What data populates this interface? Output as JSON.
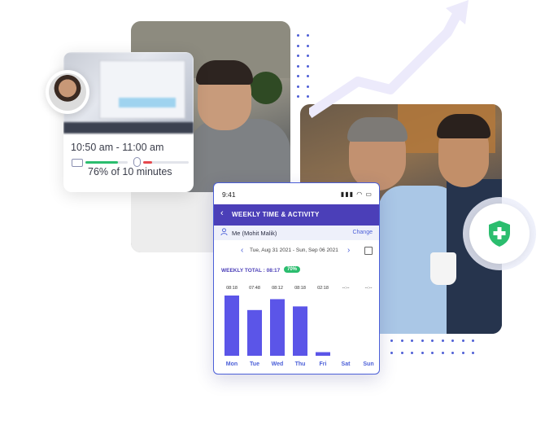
{
  "activity_card": {
    "time_range": "10:50 am - 11:00 am",
    "percent_text": "76% of 10 minutes",
    "keyboard_level": 0.76,
    "mouse_level": 0.2
  },
  "phone": {
    "status_time": "9:41",
    "header_title": "WEEKLY TIME & ACTIVITY",
    "user_name": "Me (Mohit Malik)",
    "change_label": "Change",
    "date_range": "Tue, Aug 31 2021 - Sun, Sep 06 2021",
    "weekly_total_label": "WEEKLY TOTAL : 08:17",
    "weekly_badge": "70%"
  },
  "colors": {
    "accent": "#4b3fb8",
    "bar": "#5b55e8",
    "shield": "#2bbd6e",
    "keyboard_fill": "#2bbd6e",
    "mouse_fill": "#e5484d"
  },
  "chart_data": {
    "type": "bar",
    "categories": [
      "Mon",
      "Tue",
      "Wed",
      "Thu",
      "Fri",
      "Sat",
      "Sun"
    ],
    "labels": [
      "08:18",
      "07:48",
      "08:12",
      "08:18",
      "02:18",
      "--:--",
      "--:--"
    ],
    "values": [
      8.3,
      6.3,
      7.8,
      6.8,
      0.5,
      0,
      0
    ],
    "ylim": [
      0,
      8.3
    ]
  },
  "icons": [
    "keyboard-icon",
    "mouse-icon",
    "shield-plus-icon",
    "trend-arrow-icon",
    "calendar-icon",
    "user-icon",
    "back-arrow-icon"
  ]
}
